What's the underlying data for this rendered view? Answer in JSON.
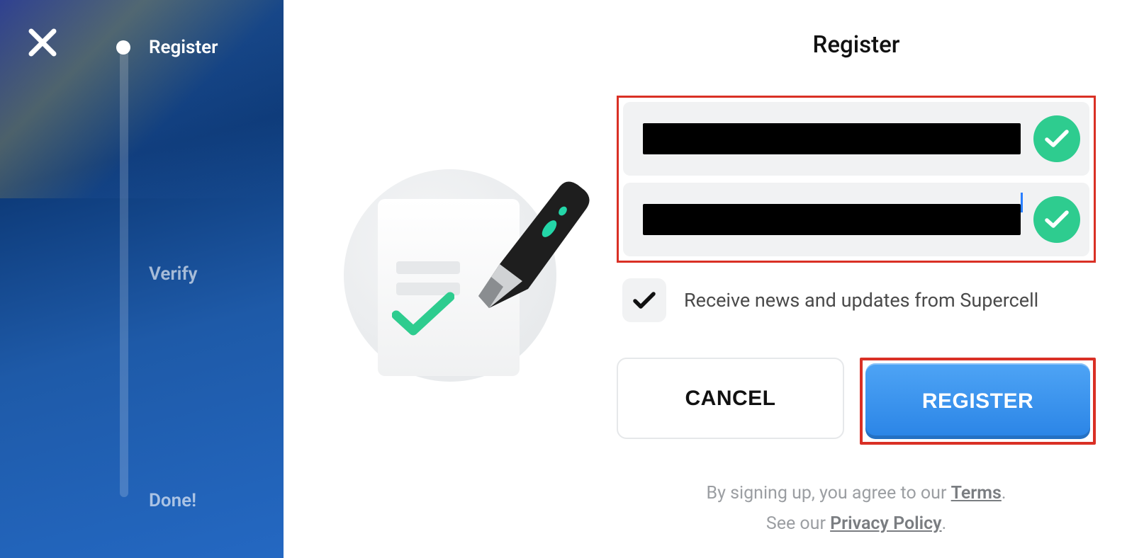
{
  "stepper": {
    "items": [
      {
        "label": "Register",
        "active": true
      },
      {
        "label": "Verify",
        "active": false
      },
      {
        "label": "Done!",
        "active": false
      }
    ]
  },
  "form": {
    "title": "Register",
    "checkbox_label": "Receive news and updates from Supercell",
    "cancel_label": "CANCEL",
    "register_label": "REGISTER"
  },
  "legal": {
    "line1_pre": "By signing up, you agree to our ",
    "terms_label": "Terms",
    "line1_post": ".",
    "line2_pre": "See our ",
    "privacy_label": "Privacy Policy",
    "line2_post": "."
  }
}
